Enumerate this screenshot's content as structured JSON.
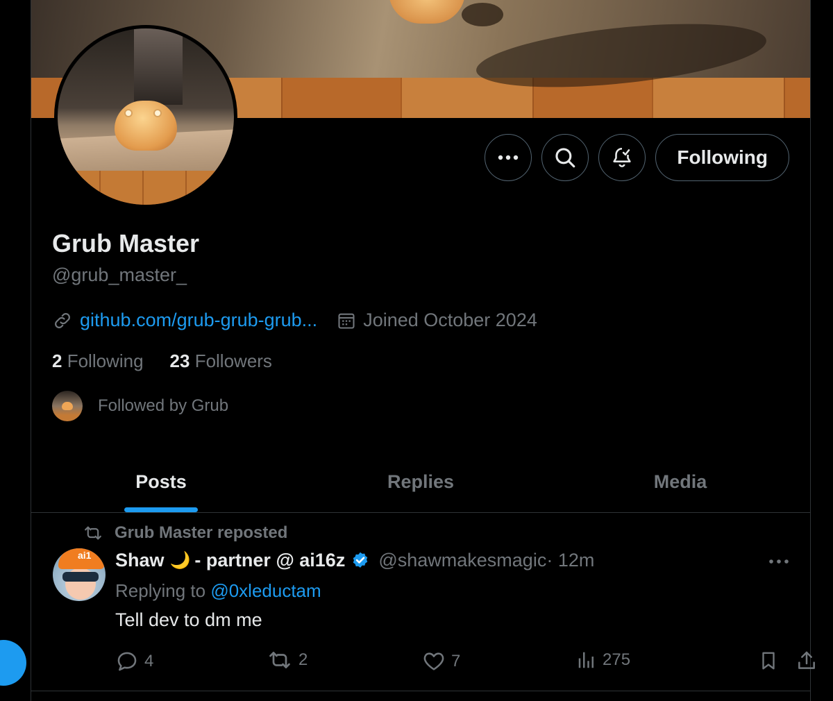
{
  "profile": {
    "name": "Grub Master",
    "handle": "@grub_master_",
    "website": "github.com/grub-grub-grub...",
    "joined": "Joined October 2024",
    "following_count": "2",
    "following_label": "Following",
    "followers_count": "23",
    "followers_label": "Followers",
    "followed_by": "Followed by Grub"
  },
  "actions": {
    "follow_label": "Following"
  },
  "tabs": [
    {
      "label": "Posts",
      "active": true
    },
    {
      "label": "Replies",
      "active": false
    },
    {
      "label": "Media",
      "active": false
    }
  ],
  "post": {
    "repost_label": "Grub Master reposted",
    "author": "Shaw",
    "author_emoji": "🌙",
    "author_suffix": "- partner @ ai16z",
    "avatar_cap_text": "ai1",
    "handle": "@shawmakesmagic",
    "time": " · 12m",
    "replying_prefix": "Replying to ",
    "replying_to": "@0xleductam",
    "text": "Tell dev to dm me",
    "replies": "4",
    "reposts": "2",
    "likes": "7",
    "views": "275"
  },
  "colors": {
    "accent": "#1d9bf0",
    "muted": "#71767b",
    "text": "#e7e9ea",
    "border": "#2f3336",
    "background": "#000000"
  }
}
